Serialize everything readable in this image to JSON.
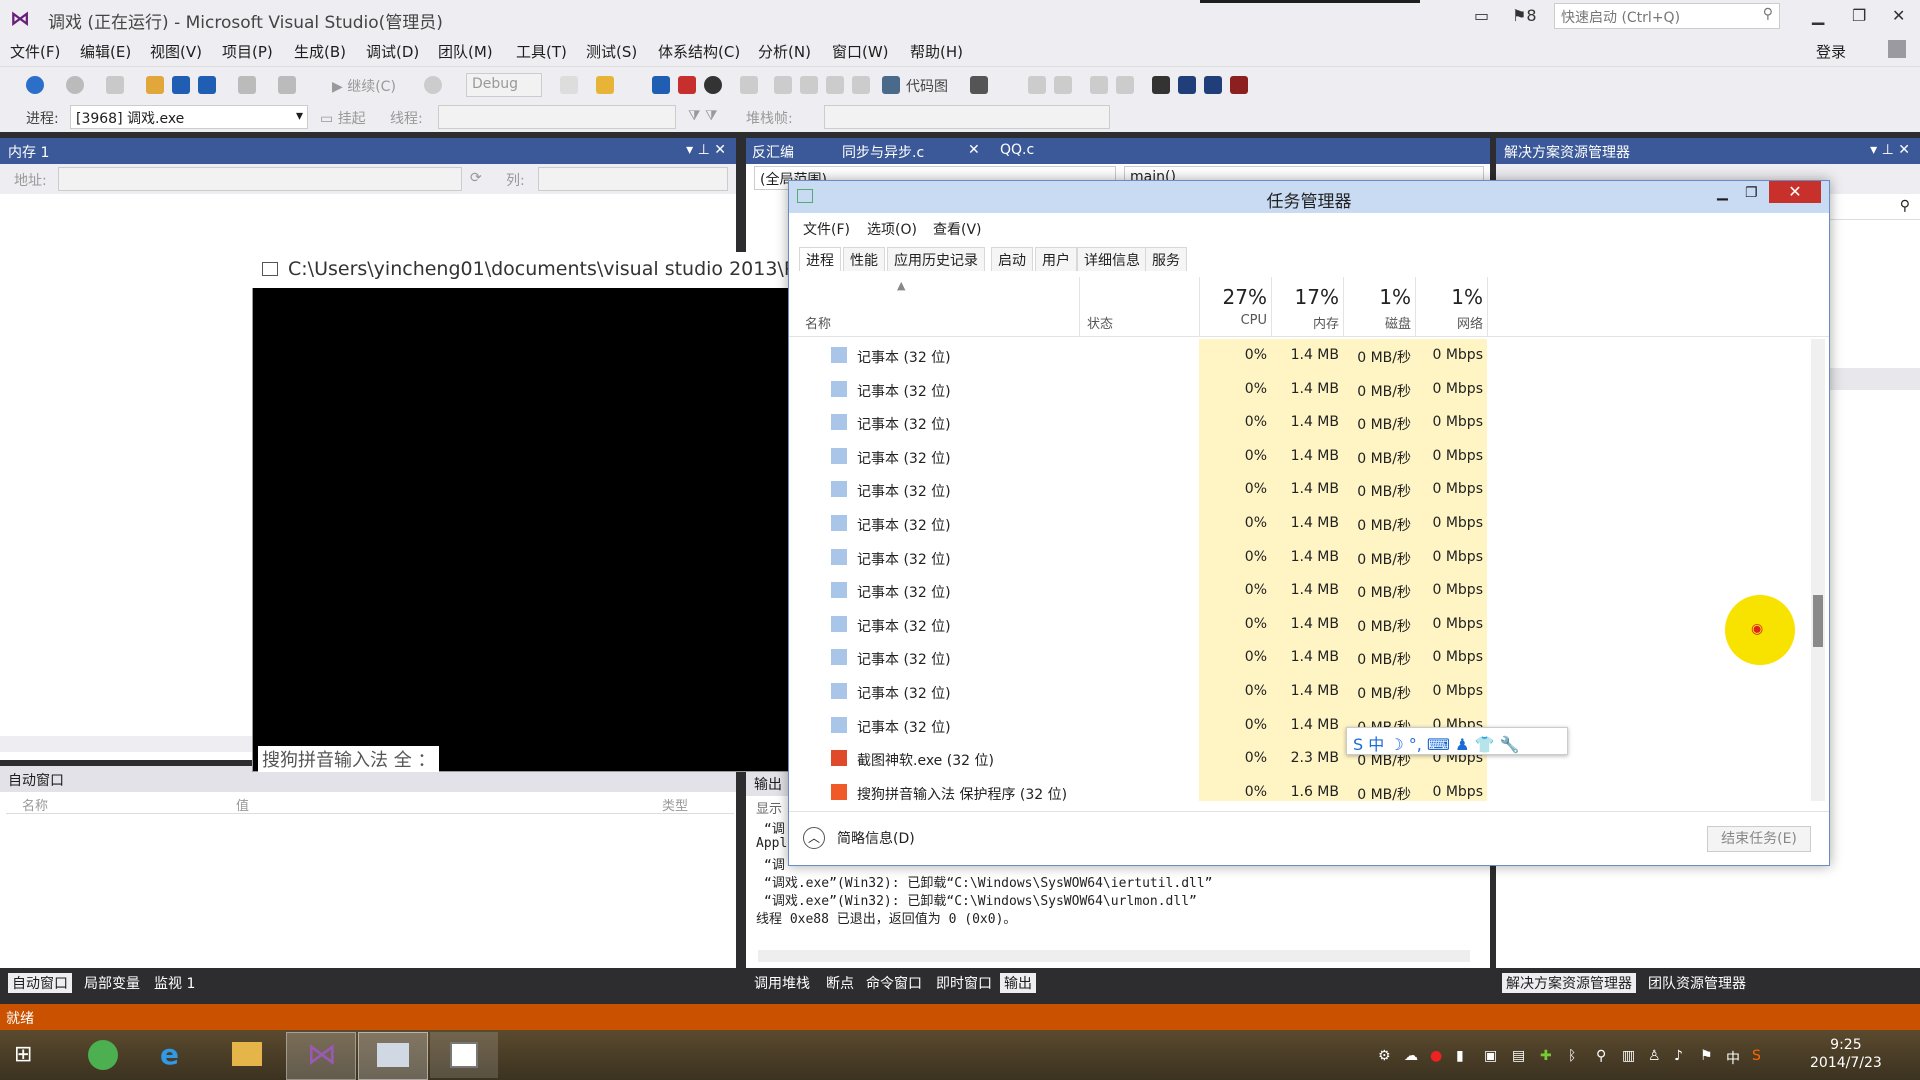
{
  "window": {
    "title": "调戏 (正在运行) - Microsoft Visual Studio(管理员)",
    "notification_count": "8",
    "quick_launch_placeholder": "快速启动 (Ctrl+Q)",
    "login": "登录",
    "min": "▁",
    "max": "❐",
    "close": "✕"
  },
  "menu": [
    "文件(F)",
    "编辑(E)",
    "视图(V)",
    "项目(P)",
    "生成(B)",
    "调试(D)",
    "团队(M)",
    "工具(T)",
    "测试(S)",
    "体系结构(C)",
    "分析(N)",
    "窗口(W)",
    "帮助(H)"
  ],
  "toolbar": {
    "continue": "继续(C)",
    "config": "Debug",
    "code_map": "代码图",
    "process_label": "进程:",
    "process_value": "[3968] 调戏.exe",
    "suspend": "挂起",
    "thread_label": "线程:",
    "stack_label": "堆栈帧:"
  },
  "memory_pane": {
    "title": "内存 1",
    "address_label": "地址:",
    "column_label": "列:"
  },
  "auto_pane": {
    "title": "自动窗口",
    "col_name": "名称",
    "col_value": "值",
    "col_type": "类型",
    "tabs": [
      "自动窗口",
      "局部变量",
      "监视 1"
    ]
  },
  "editor": {
    "tabs": [
      "反汇编",
      "同步与异步.c",
      "QQ.c"
    ],
    "scope": "(全局范围)",
    "func": "main()"
  },
  "console": {
    "title": "C:\\Users\\yincheng01\\documents\\visual studio 2013\\Proje",
    "ime_text": "搜狗拼音输入法 全 ："
  },
  "output": {
    "tab_label": "输出",
    "show_label": "显示",
    "lines": [
      "“调",
      "Appl",
      "“调",
      "“调戏.exe”(Win32):  已卸载“C:\\Windows\\SysWOW64\\iertutil.dll”",
      "“调戏.exe”(Win32):  已卸载“C:\\Windows\\SysWOW64\\urlmon.dll”",
      "线程 0xe88 已退出，返回值为 0 (0x0)。"
    ],
    "tabs": [
      "调用堆栈",
      "断点",
      "命令窗口",
      "即时窗口",
      "输出"
    ]
  },
  "solution_pane": {
    "title": "解决方案资源管理器",
    "tabs": [
      "解决方案资源管理器",
      "团队资源管理器"
    ]
  },
  "task_manager": {
    "title": "任务管理器",
    "menu": [
      "文件(F)",
      "选项(O)",
      "查看(V)"
    ],
    "tabs": [
      "进程",
      "性能",
      "应用历史记录",
      "启动",
      "用户",
      "详细信息",
      "服务"
    ],
    "columns": {
      "name": "名称",
      "status": "状态",
      "cpu_pct": "27%",
      "cpu": "CPU",
      "mem_pct": "17%",
      "mem": "内存",
      "disk_pct": "1%",
      "disk": "磁盘",
      "net_pct": "1%",
      "net": "网络"
    },
    "rows": [
      {
        "name": "记事本 (32 位)",
        "cpu": "0%",
        "mem": "1.4 MB",
        "disk": "0 MB/秒",
        "net": "0 Mbps",
        "icon": "notepad-icon"
      },
      {
        "name": "记事本 (32 位)",
        "cpu": "0%",
        "mem": "1.4 MB",
        "disk": "0 MB/秒",
        "net": "0 Mbps",
        "icon": "notepad-icon"
      },
      {
        "name": "记事本 (32 位)",
        "cpu": "0%",
        "mem": "1.4 MB",
        "disk": "0 MB/秒",
        "net": "0 Mbps",
        "icon": "notepad-icon"
      },
      {
        "name": "记事本 (32 位)",
        "cpu": "0%",
        "mem": "1.4 MB",
        "disk": "0 MB/秒",
        "net": "0 Mbps",
        "icon": "notepad-icon"
      },
      {
        "name": "记事本 (32 位)",
        "cpu": "0%",
        "mem": "1.4 MB",
        "disk": "0 MB/秒",
        "net": "0 Mbps",
        "icon": "notepad-icon"
      },
      {
        "name": "记事本 (32 位)",
        "cpu": "0%",
        "mem": "1.4 MB",
        "disk": "0 MB/秒",
        "net": "0 Mbps",
        "icon": "notepad-icon"
      },
      {
        "name": "记事本 (32 位)",
        "cpu": "0%",
        "mem": "1.4 MB",
        "disk": "0 MB/秒",
        "net": "0 Mbps",
        "icon": "notepad-icon"
      },
      {
        "name": "记事本 (32 位)",
        "cpu": "0%",
        "mem": "1.4 MB",
        "disk": "0 MB/秒",
        "net": "0 Mbps",
        "icon": "notepad-icon"
      },
      {
        "name": "记事本 (32 位)",
        "cpu": "0%",
        "mem": "1.4 MB",
        "disk": "0 MB/秒",
        "net": "0 Mbps",
        "icon": "notepad-icon"
      },
      {
        "name": "记事本 (32 位)",
        "cpu": "0%",
        "mem": "1.4 MB",
        "disk": "0 MB/秒",
        "net": "0 Mbps",
        "icon": "notepad-icon"
      },
      {
        "name": "记事本 (32 位)",
        "cpu": "0%",
        "mem": "1.4 MB",
        "disk": "0 MB/秒",
        "net": "0 Mbps",
        "icon": "notepad-icon"
      },
      {
        "name": "记事本 (32 位)",
        "cpu": "0%",
        "mem": "1.4 MB",
        "disk": "0 MB/秒",
        "net": "0 Mbps",
        "icon": "notepad-icon"
      },
      {
        "name": "截图神软.exe (32 位)",
        "cpu": "0%",
        "mem": "2.3 MB",
        "disk": "0 MB/秒",
        "net": "0 Mbps",
        "icon": "screenshot-app-icon"
      },
      {
        "name": "搜狗拼音输入法 保护程序 (32 位)",
        "cpu": "0%",
        "mem": "1.6 MB",
        "disk": "0 MB/秒",
        "net": "0 Mbps",
        "icon": "sogou-icon"
      }
    ],
    "fewer_details": "简略信息(D)",
    "end_task": "结束任务(E)"
  },
  "ime_bar": "S 中 ☽ °, ⌨ ♟ 👕 🔧",
  "statusbar": "就绪",
  "clock": {
    "time": "9:25",
    "date": "2014/7/23"
  },
  "tray_ime": "中"
}
